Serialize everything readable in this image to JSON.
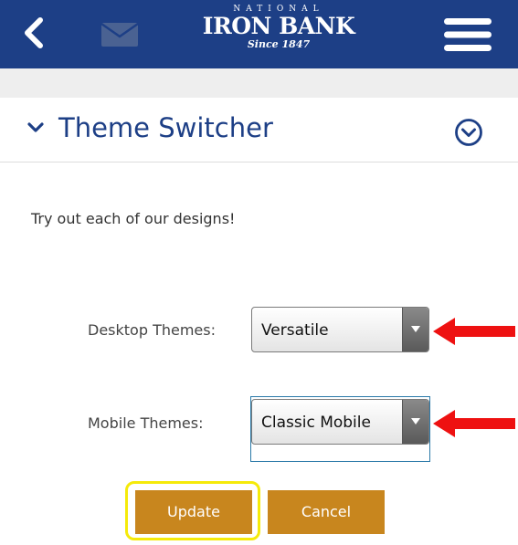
{
  "header": {
    "logo_top": "NATIONAL",
    "logo_main": "IRON BANK",
    "logo_since": "Since 1847",
    "icons": {
      "back": "chevron-left-icon",
      "mail": "envelope-icon",
      "menu": "hamburger-menu-icon"
    }
  },
  "section": {
    "title": "Theme Switcher",
    "icons": {
      "left": "chevron-down-icon",
      "right": "circle-chevron-down-icon"
    }
  },
  "intro_text": "Try out each of our designs!",
  "fields": {
    "desktop": {
      "label": "Desktop Themes:",
      "value": "Versatile"
    },
    "mobile": {
      "label": "Mobile Themes:",
      "value": "Classic Mobile"
    }
  },
  "buttons": {
    "update": "Update",
    "cancel": "Cancel"
  },
  "colors": {
    "header_bg": "#1d3f86",
    "title": "#1d3f86",
    "button": "#c8861e",
    "annotation_arrow": "#ee1111",
    "highlight": "#f5ea0a"
  }
}
